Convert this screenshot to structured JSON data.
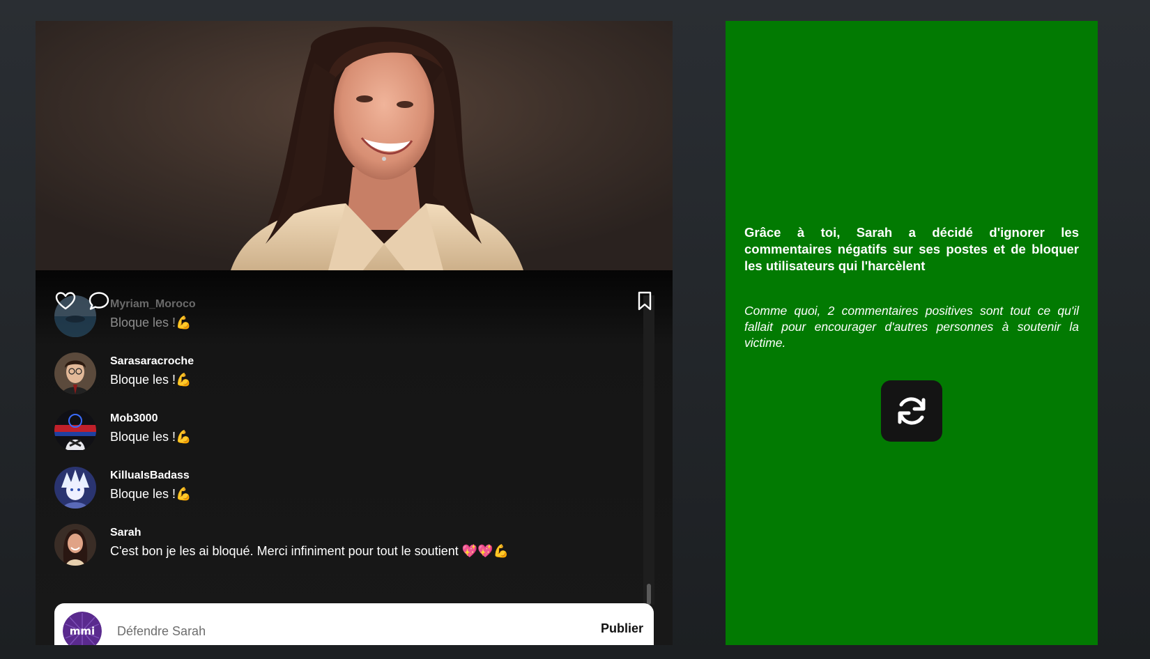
{
  "post": {
    "photo_alt": "Sarah",
    "icons": {
      "like": "heart-icon",
      "comment": "speech-bubble-icon",
      "save": "bookmark-icon"
    },
    "comments": [
      {
        "user": "Myriam_Moroco",
        "text": "Bloque les !💪",
        "faded": true
      },
      {
        "user": "Sarasaracroche",
        "text": "Bloque les !💪"
      },
      {
        "user": "Mob3000",
        "text": "Bloque les !💪"
      },
      {
        "user": "KilluaIsBadass",
        "text": "Bloque les !💪"
      },
      {
        "user": "Sarah",
        "text": "C'est bon je les ai bloqué. Merci infiniment pour tout le soutient 💖💖💪"
      }
    ],
    "composer": {
      "avatar_label": "mmi",
      "placeholder": "Défendre Sarah",
      "value": "",
      "publish_label": "Publier"
    }
  },
  "result": {
    "message": "Grâce à toi, Sarah a décidé d'ignorer les commentaires négatifs sur ses postes et de bloquer les utilisateurs qui l'harcèlent",
    "submessage": "Comme quoi, 2 commentaires positives sont tout ce qu'il fallait pour encourager d'autres personnes à soutenir la victime.",
    "restart_icon": "refresh-icon"
  },
  "colors": {
    "result_bg": "#027a02",
    "page_bg": "#1f2225",
    "post_bg": "#181818",
    "composer_bg": "#ffffff"
  }
}
